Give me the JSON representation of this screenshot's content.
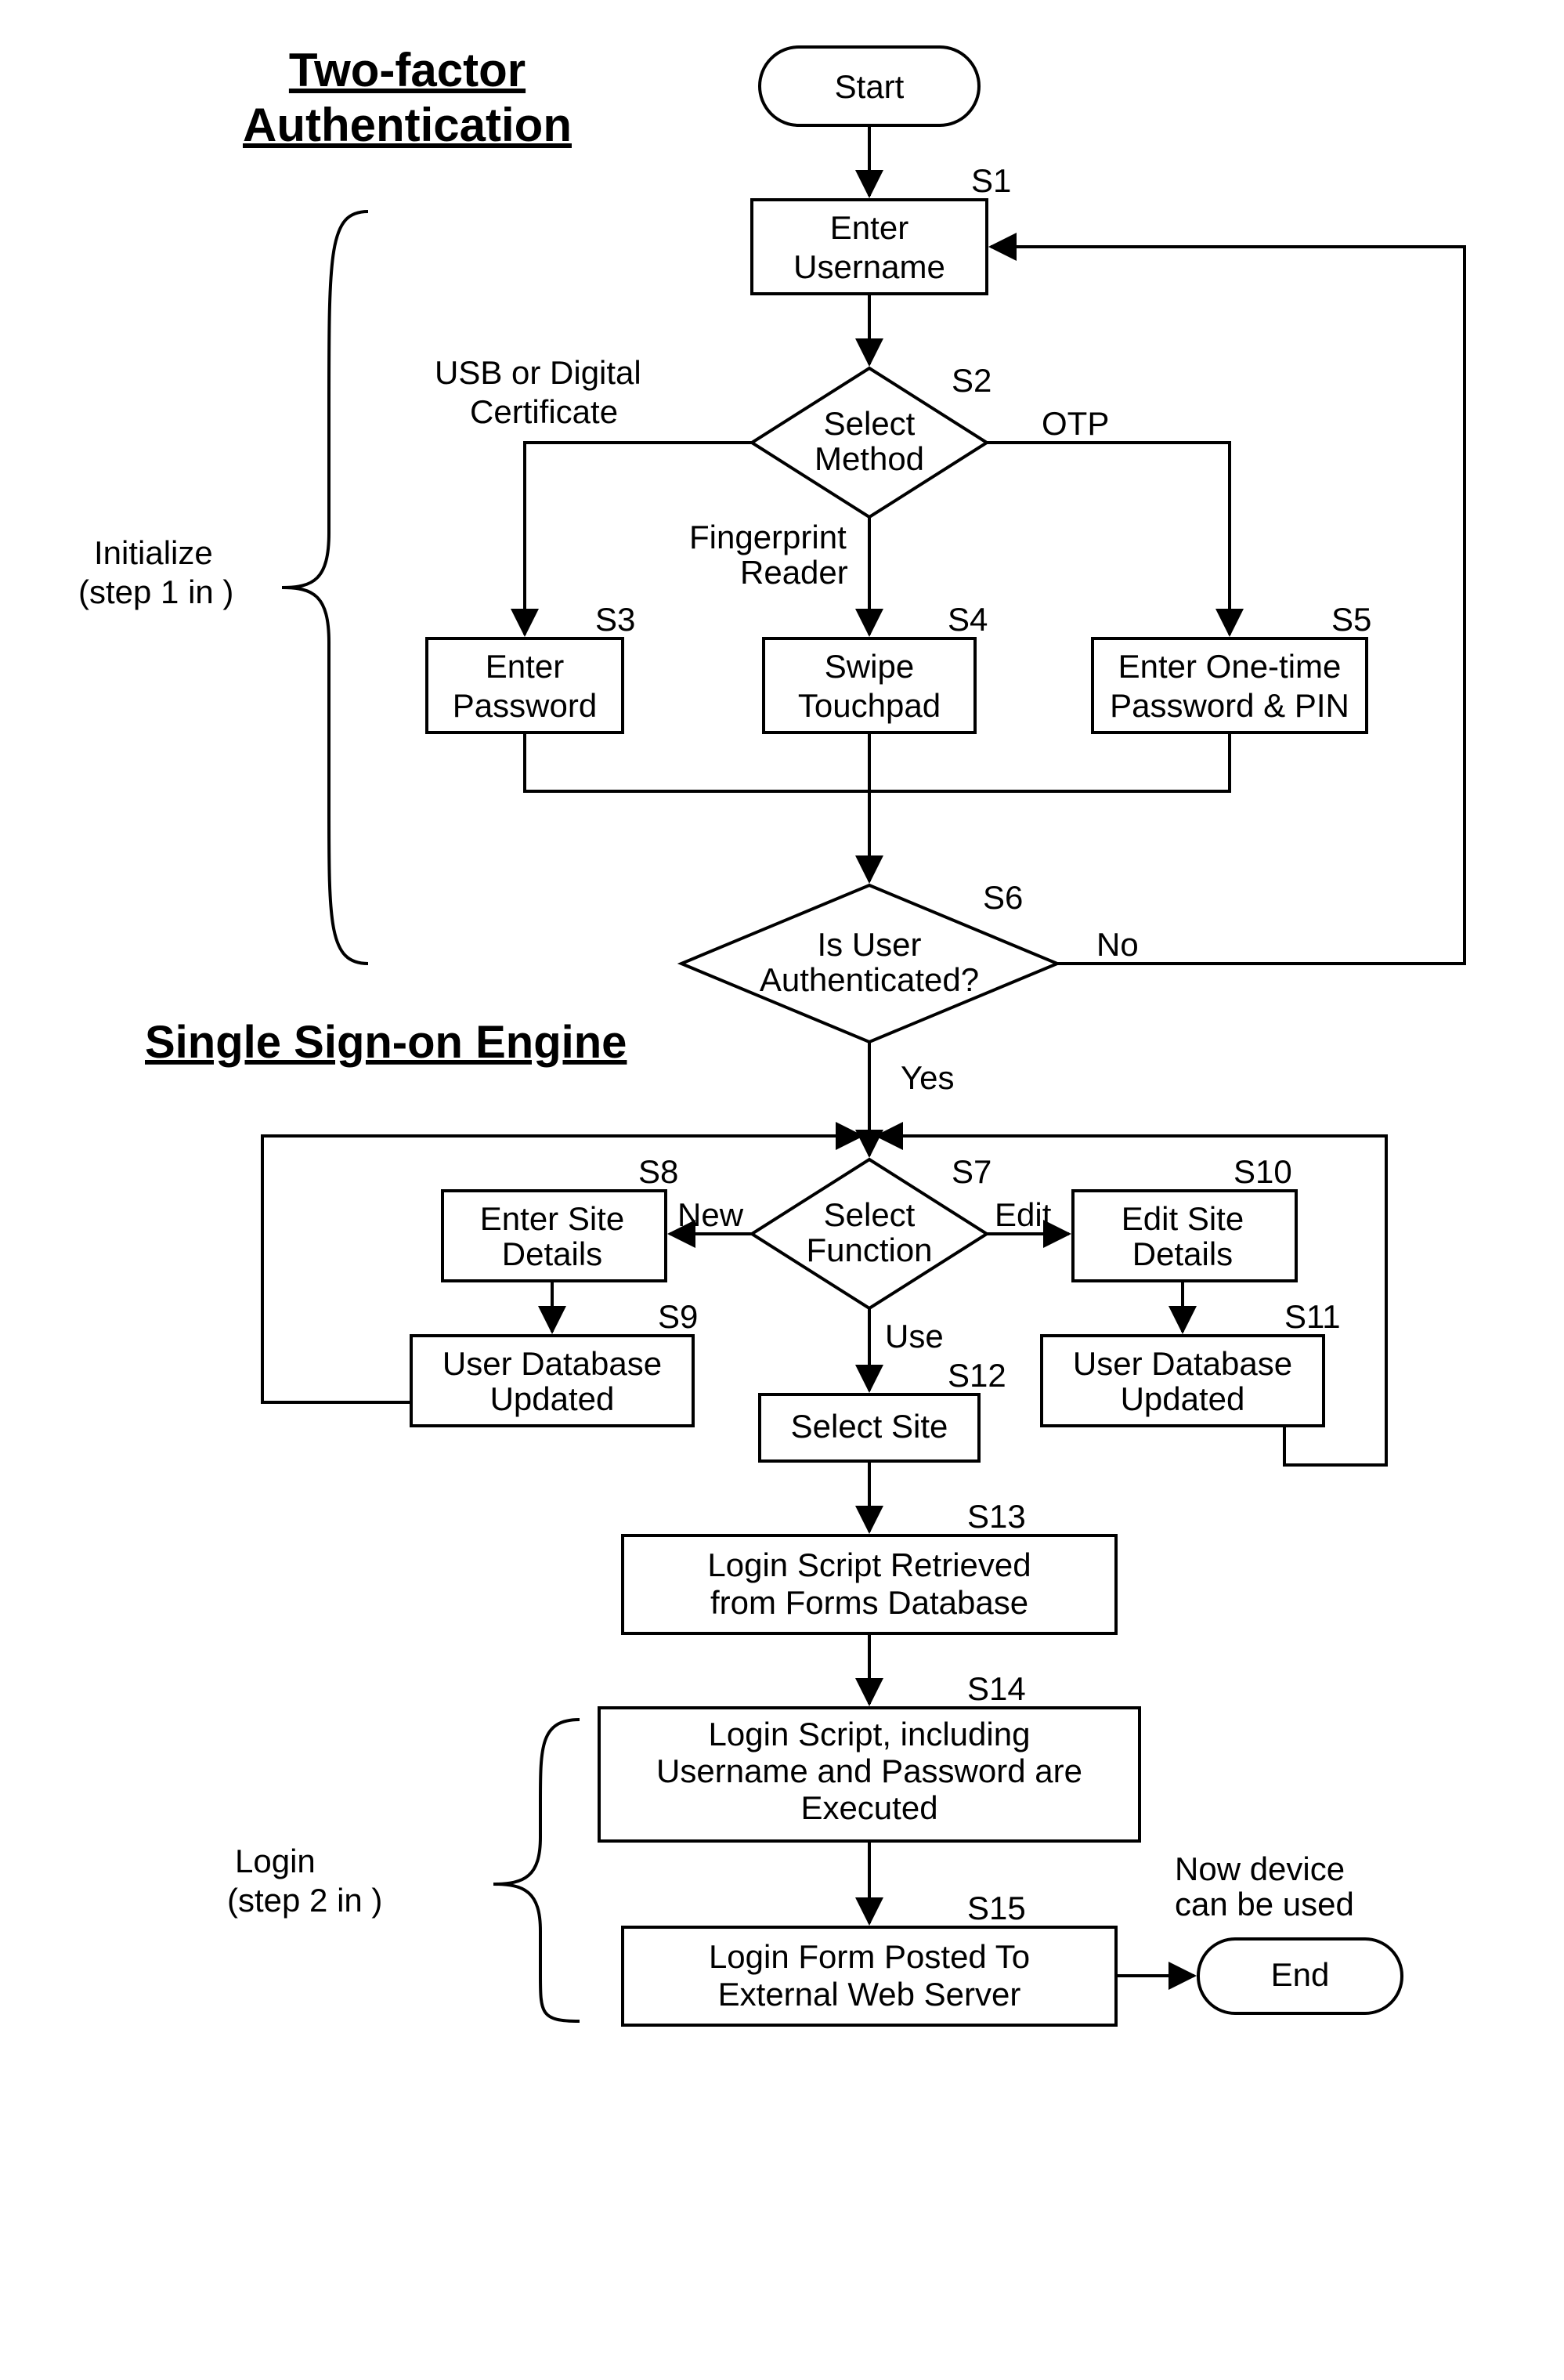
{
  "title": {
    "line1": "Two-factor",
    "line2": "Authentication"
  },
  "section2": "Single Sign-on Engine",
  "sideGroup1": {
    "line1": "Initialize",
    "line2": "(step 1 in        )"
  },
  "sideGroup2": {
    "line1": "Login",
    "line2": "(step 2 in        )"
  },
  "start": "Start",
  "end": "End",
  "nodes": {
    "s1": {
      "tag": "S1",
      "line1": "Enter",
      "line2": "Username"
    },
    "s2": {
      "tag": "S2",
      "line1": "Select",
      "line2": "Method"
    },
    "s3": {
      "tag": "S3",
      "line1": "Enter",
      "line2": "Password"
    },
    "s4": {
      "tag": "S4",
      "line1": "Swipe",
      "line2": "Touchpad"
    },
    "s5": {
      "tag": "S5",
      "line1": "Enter One-time",
      "line2": "Password & PIN"
    },
    "s6": {
      "tag": "S6",
      "line1": "Is User",
      "line2": "Authenticated?"
    },
    "s7": {
      "tag": "S7",
      "line1": "Select",
      "line2": "Function"
    },
    "s8": {
      "tag": "S8",
      "line1": "Enter Site",
      "line2": "Details"
    },
    "s9": {
      "tag": "S9",
      "line1": "User Database",
      "line2": "Updated"
    },
    "s10": {
      "tag": "S10",
      "line1": "Edit Site",
      "line2": "Details"
    },
    "s11": {
      "tag": "S11",
      "line1": "User Database",
      "line2": "Updated"
    },
    "s12": {
      "tag": "S12",
      "line1": "Select Site"
    },
    "s13": {
      "tag": "S13",
      "line1": "Login Script Retrieved",
      "line2": "from Forms Database"
    },
    "s14": {
      "tag": "S14",
      "line1": "Login Script, including",
      "line2": "Username and Password are",
      "line3": "Executed"
    },
    "s15": {
      "tag": "S15",
      "line1": "Login Form Posted To",
      "line2": "External Web Server"
    }
  },
  "edgeLabels": {
    "usb": {
      "line1": "USB or Digital",
      "line2": "Certificate"
    },
    "fingerprint": {
      "line1": "Fingerprint",
      "line2": "Reader"
    },
    "otp": "OTP",
    "no": "No",
    "yes": "Yes",
    "new": "New",
    "edit": "Edit",
    "use": "Use",
    "nowDevice": {
      "line1": "Now device",
      "line2": "can be used"
    }
  }
}
